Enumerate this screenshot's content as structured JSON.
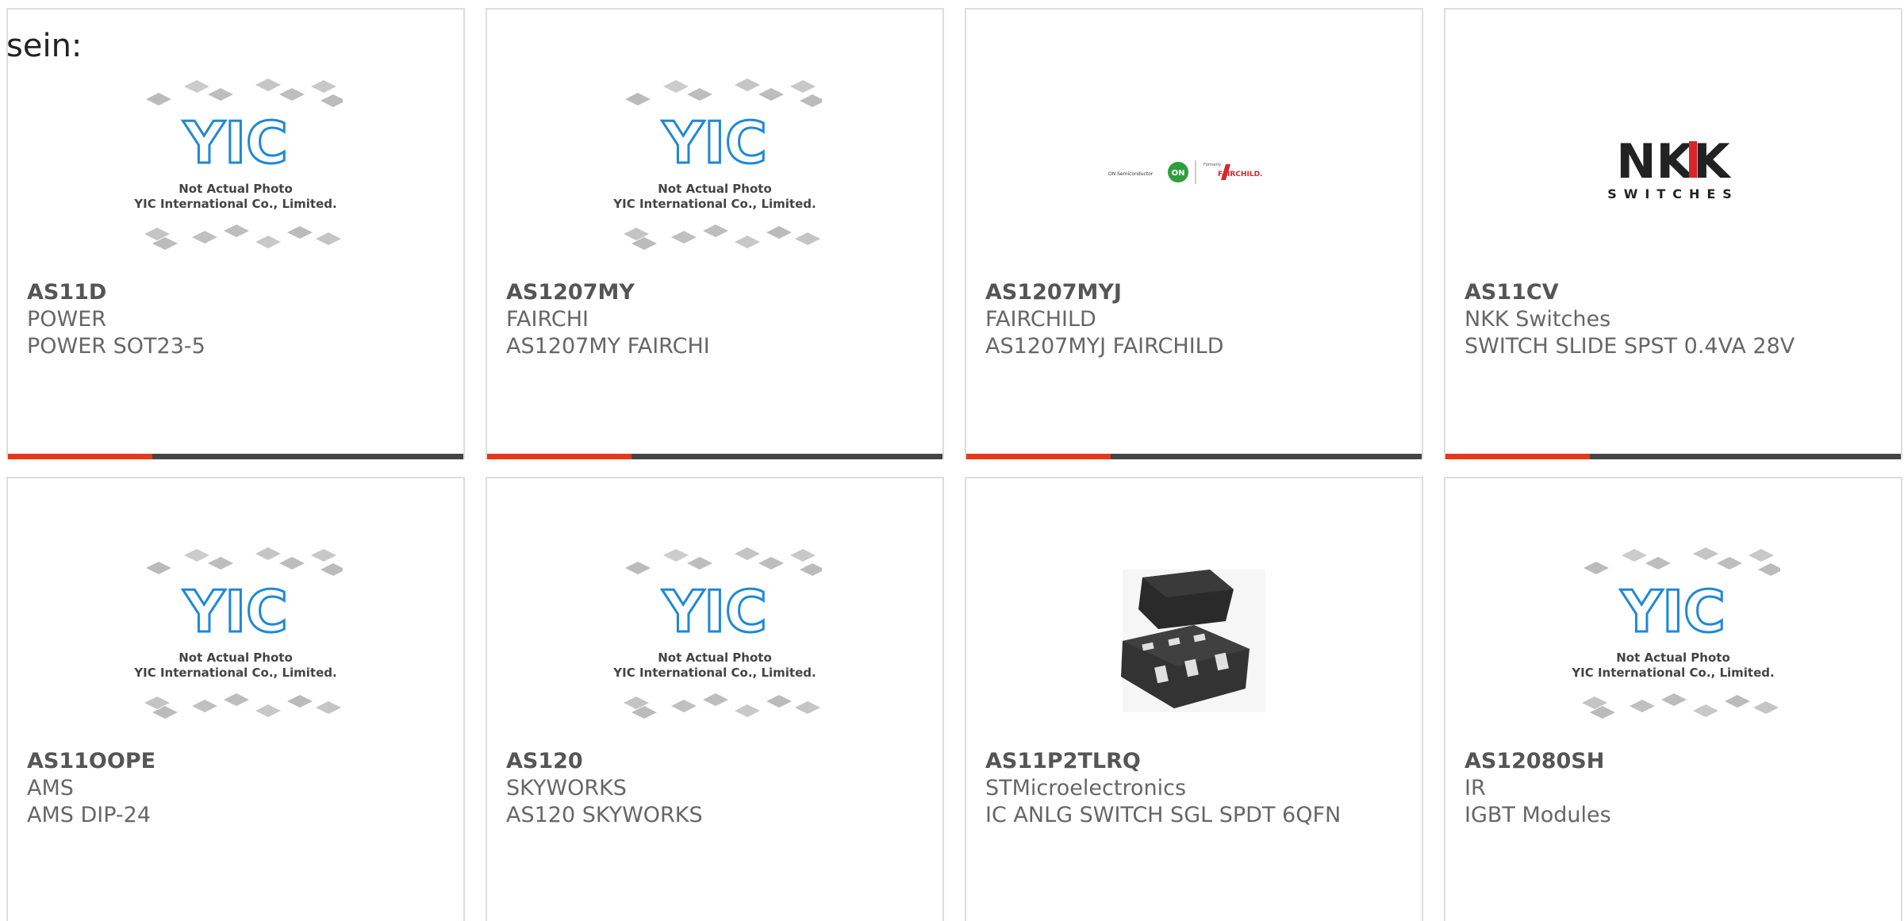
{
  "intro_text": "sein:",
  "colors": {
    "accent": "#e5381a",
    "bar": "#444444",
    "border": "#dddddd",
    "yic_blue": "#1e88d8",
    "nkk_red": "#d8262b"
  },
  "placeholder": {
    "logo_text": "YIC",
    "line1": "Not Actual Photo",
    "line2": "YIC International Co., Limited."
  },
  "fairchild_logo": {
    "left": "ON Semiconductor",
    "mark": "ON",
    "small": "Formerly",
    "name": "FAIRCHILD."
  },
  "nkk_logo": {
    "name": "NKK",
    "sub": "SWITCHES"
  },
  "products": [
    {
      "part": "AS11D",
      "manufacturer": "POWER",
      "description": "POWER SOT23-5",
      "image": "placeholder"
    },
    {
      "part": "AS1207MY",
      "manufacturer": "FAIRCHI",
      "description": "AS1207MY FAIRCHI",
      "image": "placeholder"
    },
    {
      "part": "AS1207MYJ",
      "manufacturer": "FAIRCHILD",
      "description": "AS1207MYJ FAIRCHILD",
      "image": "fairchild-logo"
    },
    {
      "part": "AS11CV",
      "manufacturer": "NKK Switches",
      "description": "SWITCH SLIDE SPST 0.4VA 28V",
      "image": "nkk-logo"
    },
    {
      "part": "AS11OOPE",
      "manufacturer": "AMS",
      "description": "AMS DIP-24",
      "image": "placeholder"
    },
    {
      "part": "AS120",
      "manufacturer": "SKYWORKS",
      "description": "AS120 SKYWORKS",
      "image": "placeholder"
    },
    {
      "part": "AS11P2TLRQ",
      "manufacturer": "STMicroelectronics",
      "description": "IC ANLG SWITCH SGL SPDT 6QFN",
      "image": "qfn-chip-photo"
    },
    {
      "part": "AS12080SH",
      "manufacturer": "IR",
      "description": "IGBT Modules",
      "image": "placeholder"
    }
  ]
}
